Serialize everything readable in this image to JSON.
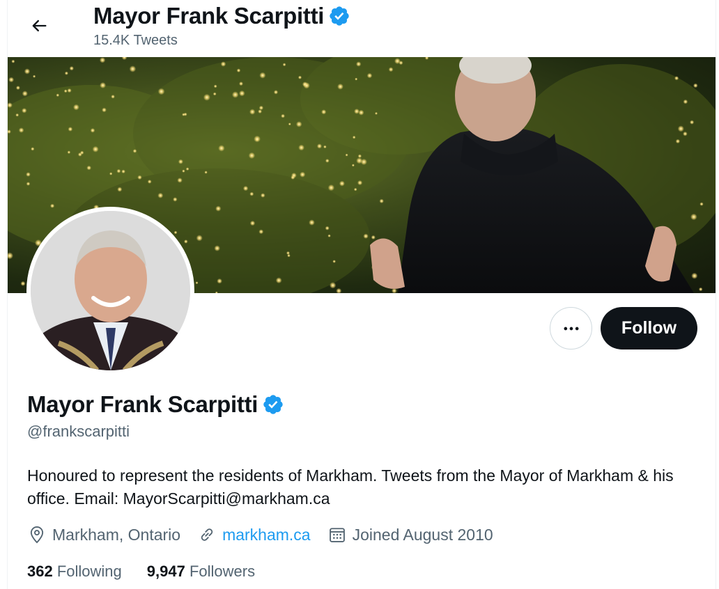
{
  "header": {
    "title": "Mayor Frank Scarpitti",
    "tweet_count": "15.4K Tweets"
  },
  "profile": {
    "name": "Mayor Frank Scarpitti",
    "handle": "@frankscarpitti",
    "bio": "Honoured to represent the residents of Markham. Tweets from the Mayor of Markham & his office. Email: MayorScarpitti@markham.ca",
    "location": "Markham, Ontario",
    "website": "markham.ca",
    "joined": "Joined August 2010",
    "following_count": "362",
    "following_label": "Following",
    "followers_count": "9,947",
    "followers_label": "Followers"
  },
  "actions": {
    "follow_label": "Follow"
  },
  "icons": {
    "back": "arrow-left-icon",
    "verified": "verified-badge-icon",
    "more": "more-horizontal-icon",
    "location": "location-pin-icon",
    "link": "link-icon",
    "calendar": "calendar-icon"
  },
  "colors": {
    "accent": "#1d9bf0",
    "text_primary": "#0f1419",
    "text_secondary": "#536471",
    "follow_button": "#0f1419"
  }
}
